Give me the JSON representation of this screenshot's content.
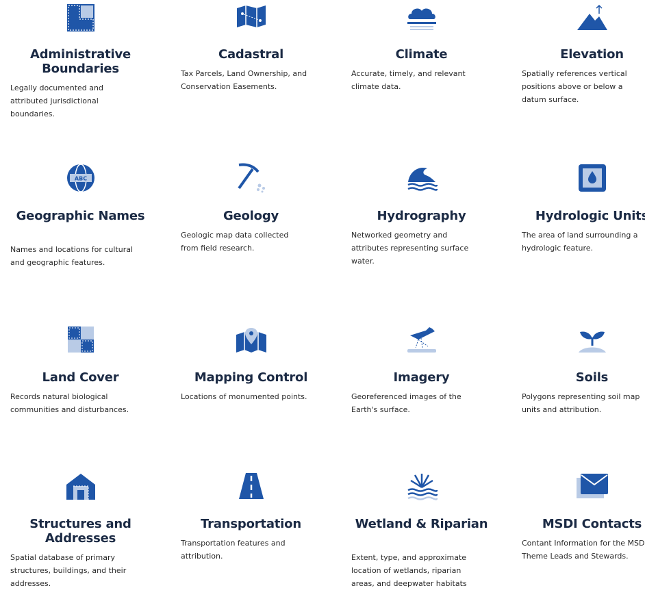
{
  "colors": {
    "icon_primary": "#1f56a8",
    "icon_light": "#b9cbe6",
    "title": "#1b2a44",
    "text": "#2a2a2a"
  },
  "themes": [
    {
      "name": "Administrative Boundaries",
      "desc": "Legally documented and attributed jurisdictional boundaries.",
      "icon": "boundary-icon"
    },
    {
      "name": "Cadastral",
      "desc": "Tax Parcels, Land Ownership, and Conservation Easements.",
      "icon": "parcel-map-icon"
    },
    {
      "name": "Climate",
      "desc": "Accurate, timely, and relevant climate data.",
      "icon": "cloud-icon"
    },
    {
      "name": "Elevation",
      "desc": "Spatially references vertical positions above or below a datum surface.",
      "icon": "mountain-icon"
    },
    {
      "name": "Geographic Names",
      "desc": "Names and locations for cultural and geographic features.",
      "icon": "globe-abc-icon"
    },
    {
      "name": "Geology",
      "desc": "Geologic map data collected from field research.",
      "icon": "pickaxe-icon"
    },
    {
      "name": "Hydrography",
      "desc": "Networked geometry and attributes representing surface water.",
      "icon": "wave-icon"
    },
    {
      "name": "Hydrologic Units",
      "desc": "The area of land surrounding a hydrologic feature.",
      "icon": "water-drop-frame-icon"
    },
    {
      "name": "Land Cover",
      "desc": "Records natural biological communities and disturbances.",
      "icon": "land-cover-tiles-icon"
    },
    {
      "name": "Mapping Control",
      "desc": "Locations of monumented points.",
      "icon": "map-pin-icon"
    },
    {
      "name": "Imagery",
      "desc": "Georeferenced images of the Earth's surface.",
      "icon": "satellite-plane-icon"
    },
    {
      "name": "Soils",
      "desc": "Polygons representing soil map units and attribution.",
      "icon": "sprout-icon"
    },
    {
      "name": "Structures and Addresses",
      "desc": "Spatial database of primary structures, buildings, and their addresses.",
      "icon": "house-icon"
    },
    {
      "name": "Transportation",
      "desc": "Transportation features and attribution.",
      "icon": "road-icon"
    },
    {
      "name": "Wetland & Riparian",
      "desc": "Extent, type, and approximate location of wetlands, riparian areas, and deepwater habitats",
      "icon": "wetland-reeds-icon"
    },
    {
      "name": "MSDI Contacts",
      "desc": "Contant Information for the MSDI Theme Leads and Stewards.",
      "icon": "envelope-icon"
    }
  ]
}
